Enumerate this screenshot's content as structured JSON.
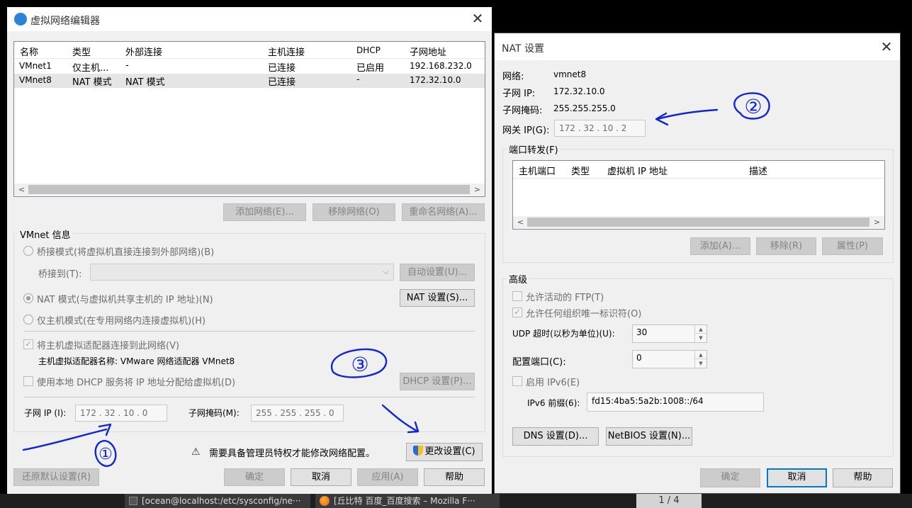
{
  "left_window": {
    "title": "虚拟网络编辑器",
    "columns": [
      "名称",
      "类型",
      "外部连接",
      "主机连接",
      "DHCP",
      "子网地址"
    ],
    "rows": [
      [
        "VMnet1",
        "仅主机...",
        "-",
        "已连接",
        "已启用",
        "192.168.232.0"
      ],
      [
        "VMnet8",
        "NAT 模式",
        "NAT 模式",
        "已连接",
        "-",
        "172.32.10.0"
      ]
    ],
    "buttons": {
      "add_network": "添加网络(E)...",
      "remove_network": "移除网络(O)",
      "rename_network": "重命名网络(A)..."
    },
    "vmnet_info": {
      "group_label": "VMnet 信息",
      "bridge_mode": "桥接模式(将虚拟机直接连接到外部网络)(B)",
      "bridge_to": "桥接到(T):",
      "auto_settings": "自动设置(U)...",
      "nat_mode": "NAT 模式(与虚拟机共享主机的 IP 地址)(N)",
      "nat_settings": "NAT 设置(S)...",
      "host_only": "仅主机模式(在专用网络内连接虚拟机)(H)",
      "connect_adapter": "将主机虚拟适配器连接到此网络(V)",
      "adapter_name": "主机虚拟适配器名称: VMware 网络适配器 VMnet8",
      "use_dhcp": "使用本地 DHCP 服务将 IP 地址分配给虚拟机(D)",
      "dhcp_settings": "DHCP 设置(P)...",
      "subnet_ip_label": "子网 IP (I):",
      "subnet_ip": "172 . 32 . 10 . 0",
      "subnet_mask_label": "子网掩码(M):",
      "subnet_mask": "255 . 255 . 255 . 0"
    },
    "admin_notice": "需要具备管理员特权才能修改网络配置。",
    "change_settings": "更改设置(C)",
    "restore_defaults": "还原默认设置(R)",
    "ok": "确定",
    "cancel": "取消",
    "apply": "应用(A)",
    "help": "帮助"
  },
  "nat_window": {
    "title": "NAT 设置",
    "network_label": "网络:",
    "network_value": "vmnet8",
    "subnet_ip_label": "子网 IP:",
    "subnet_ip_value": "172.32.10.0",
    "subnet_mask_label": "子网掩码:",
    "subnet_mask_value": "255.255.255.0",
    "gateway_label": "网关 IP(G):",
    "gateway_value": "172 . 32 . 10 . 2",
    "port_forward_label": "端口转发(F)",
    "pf_columns": [
      "主机端口",
      "类型",
      "虚拟机 IP 地址",
      "描述"
    ],
    "pf_add": "添加(A)...",
    "pf_remove": "移除(R)",
    "pf_props": "属性(P)",
    "advanced_label": "高级",
    "allow_ftp": "允许活动的 FTP(T)",
    "allow_oui": "允许任何组织唯一标识符(O)",
    "udp_timeout_label": "UDP 超时(以秒为单位)(U):",
    "udp_timeout_value": "30",
    "config_port_label": "配置端口(C):",
    "config_port_value": "0",
    "enable_ipv6": "启用 IPv6(E)",
    "ipv6_prefix_label": "IPv6 前缀(6):",
    "ipv6_prefix_value": "fd15:4ba5:5a2b:1008::/64",
    "dns_settings": "DNS 设置(D)...",
    "netbios_settings": "NetBIOS 设置(N)...",
    "ok": "确定",
    "cancel": "取消",
    "help": "帮助"
  },
  "taskbar": {
    "task1": "[ocean@localhost:/etc/sysconfig/ne···",
    "task2": "[丘比特 百度_百度搜索 – Mozilla F···",
    "pager": "1 / 4"
  },
  "annotations": [
    "①",
    "②",
    "③"
  ],
  "colors": {
    "accent": "#0078d7",
    "annotation_ink": "#1024d8",
    "selected_row": "#e5e5e5"
  }
}
